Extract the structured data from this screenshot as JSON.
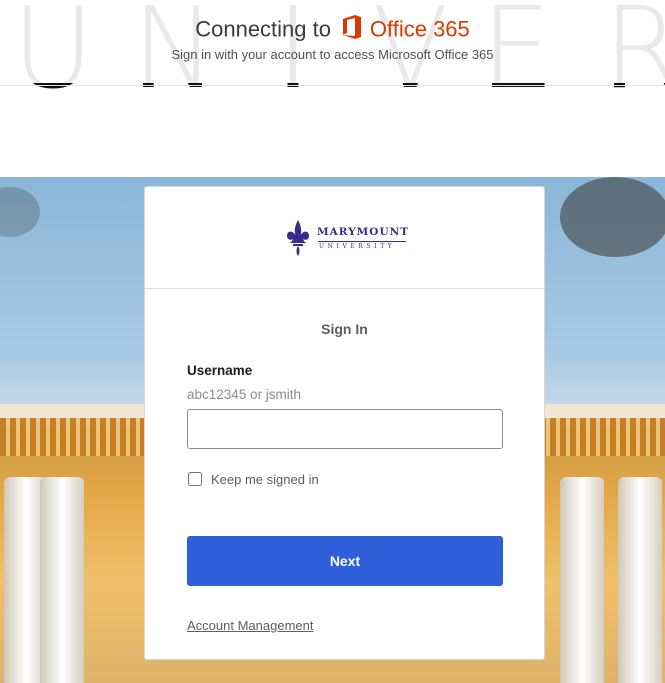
{
  "header": {
    "connecting_text": "Connecting to",
    "office_name": "Office 365",
    "subtitle": "Sign in with your account to access Microsoft Office 365",
    "background_letters": [
      "U",
      "N",
      "I",
      "V",
      "E",
      "R"
    ]
  },
  "card": {
    "logo_name": "MARYMOUNT",
    "logo_sub": "UNIVERSITY",
    "title": "Sign In",
    "username_label": "Username",
    "username_hint": "abc12345 or jsmith",
    "username_value": "",
    "keep_signed_in_label": "Keep me signed in",
    "keep_signed_in_checked": false,
    "next_label": "Next",
    "account_link": "Account Management"
  },
  "colors": {
    "office_orange": "#d83b01",
    "brand_purple": "#3a2a8c",
    "primary_button": "#2f5fd9"
  },
  "icons": {
    "office_logo": "office-365-icon",
    "university_logo": "fleur-de-lis-icon"
  }
}
